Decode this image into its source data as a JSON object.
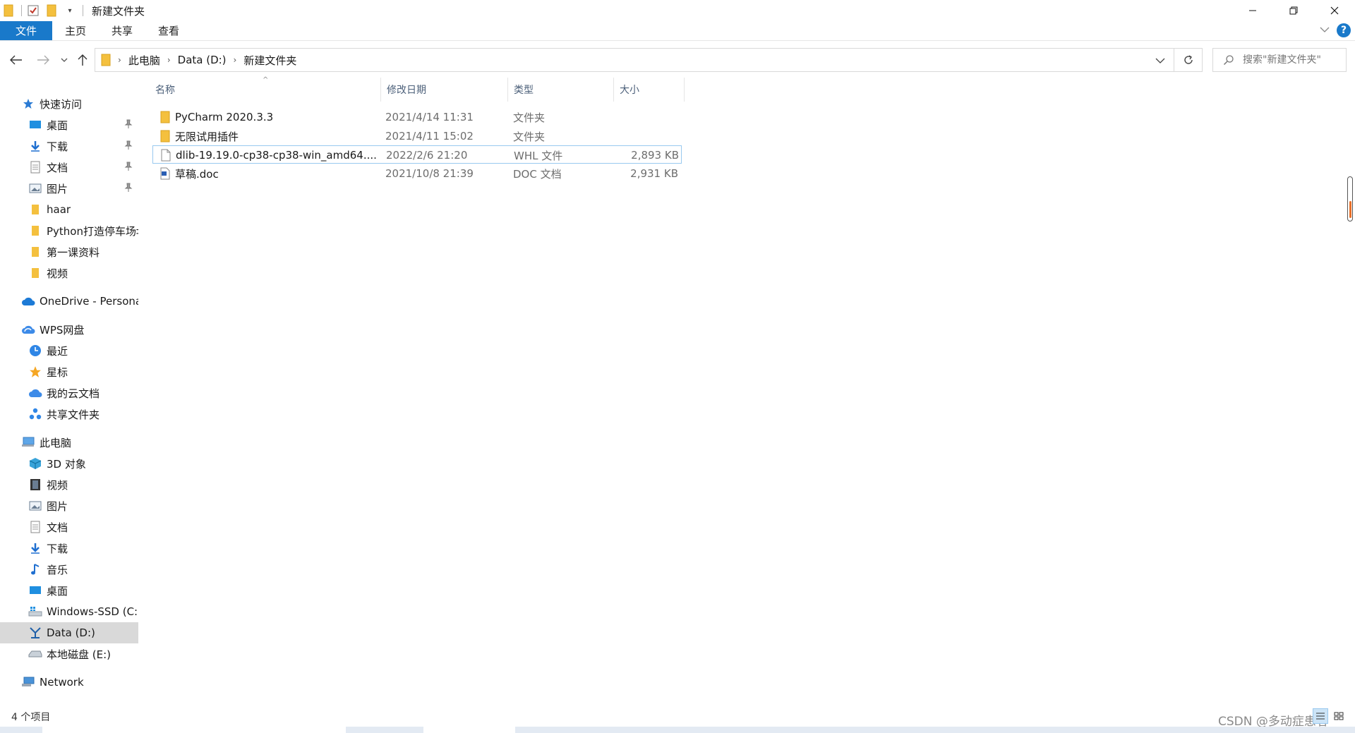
{
  "window": {
    "title": "新建文件夹"
  },
  "ribbon": {
    "tabs": [
      "文件",
      "主页",
      "共享",
      "查看"
    ]
  },
  "address": {
    "crumbs": [
      "此电脑",
      "Data (D:)",
      "新建文件夹"
    ],
    "search_placeholder": "搜索\"新建文件夹\""
  },
  "sidebar": {
    "quick_access": {
      "label": "快速访问",
      "items": [
        "桌面",
        "下载",
        "文档",
        "图片",
        "haar",
        "Python打造停车场‡",
        "第一课资料",
        "视频"
      ]
    },
    "onedrive": {
      "label": "OneDrive - Persona"
    },
    "wps": {
      "label": "WPS网盘",
      "items": [
        "最近",
        "星标",
        "我的云文档",
        "共享文件夹"
      ]
    },
    "this_pc": {
      "label": "此电脑",
      "items": [
        "3D 对象",
        "视频",
        "图片",
        "文档",
        "下载",
        "音乐",
        "桌面",
        "Windows-SSD (C:)",
        "Data (D:)",
        "本地磁盘 (E:)"
      ]
    },
    "network": {
      "label": "Network"
    }
  },
  "columns": {
    "name": "名称",
    "date": "修改日期",
    "type": "类型",
    "size": "大小"
  },
  "files": [
    {
      "name": "PyCharm 2020.3.3",
      "date": "2021/4/14 11:31",
      "type": "文件夹",
      "size": "",
      "icon": "folder-icon"
    },
    {
      "name": "无限试用插件",
      "date": "2021/4/11 15:02",
      "type": "文件夹",
      "size": "",
      "icon": "folder-icon"
    },
    {
      "name": "dlib-19.19.0-cp38-cp38-win_amd64....",
      "date": "2022/2/6 21:20",
      "type": "WHL 文件",
      "size": "2,893 KB",
      "icon": "file-icon"
    },
    {
      "name": "草稿.doc",
      "date": "2021/10/8 21:39",
      "type": "DOC 文档",
      "size": "2,931 KB",
      "icon": "doc-icon"
    }
  ],
  "status": {
    "item_count": "4 个项目"
  },
  "watermark": "CSDN @多动症患者",
  "colors": {
    "accent": "#1979ca",
    "folder": "#f4c03e",
    "selection_border": "#99c9ef"
  }
}
